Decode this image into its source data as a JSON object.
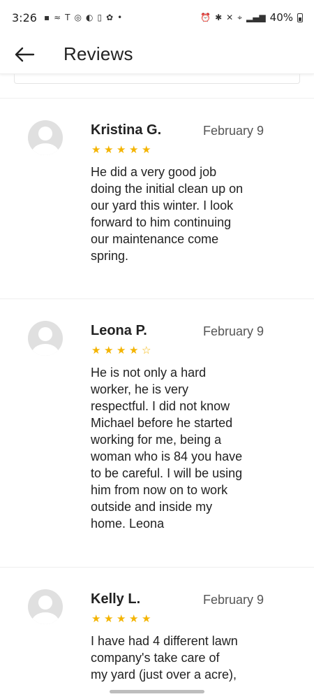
{
  "status_bar": {
    "time": "3:26",
    "left_icons": [
      "message-icon",
      "app-icon",
      "t-icon",
      "instagram-icon",
      "moon-icon",
      "phone-icon",
      "flower-icon",
      "dot-icon"
    ],
    "right_icons": [
      "alarm-icon",
      "bluetooth-icon",
      "mute-icon",
      "location-icon",
      "signal-icon"
    ],
    "battery": "40%"
  },
  "app_bar": {
    "title": "Reviews"
  },
  "reviews": [
    {
      "name": "Kristina G.",
      "date": "February 9",
      "rating": 5,
      "stars": [
        "★",
        "★",
        "★",
        "★",
        "★"
      ],
      "text": "He did a very good job\ndoing the initial clean up on\nour yard this winter. I look\nforward to him continuing\nour maintenance come\nspring."
    },
    {
      "name": "Leona P.",
      "date": "February 9",
      "rating": 4,
      "stars": [
        "★",
        "★",
        "★",
        "★",
        "☆"
      ],
      "text": "He is not only a hard\nworker, he is very\nrespectful. I did not know\nMichael before he started\nworking for me, being a\nwoman who is 84 you  have\nto be careful. I will be using\nhim from now on to work\noutside and inside my\nhome. Leona"
    },
    {
      "name": "Kelly L.",
      "date": "February 9",
      "rating": 5,
      "stars": [
        "★",
        "★",
        "★",
        "★",
        "★"
      ],
      "text": "I have had 4 different lawn\ncompany's take care of\nmy yard (just over a acre),"
    }
  ],
  "colors": {
    "star": "#f4b400",
    "avatar": "#e0e0e0",
    "separator": "#efefef"
  }
}
